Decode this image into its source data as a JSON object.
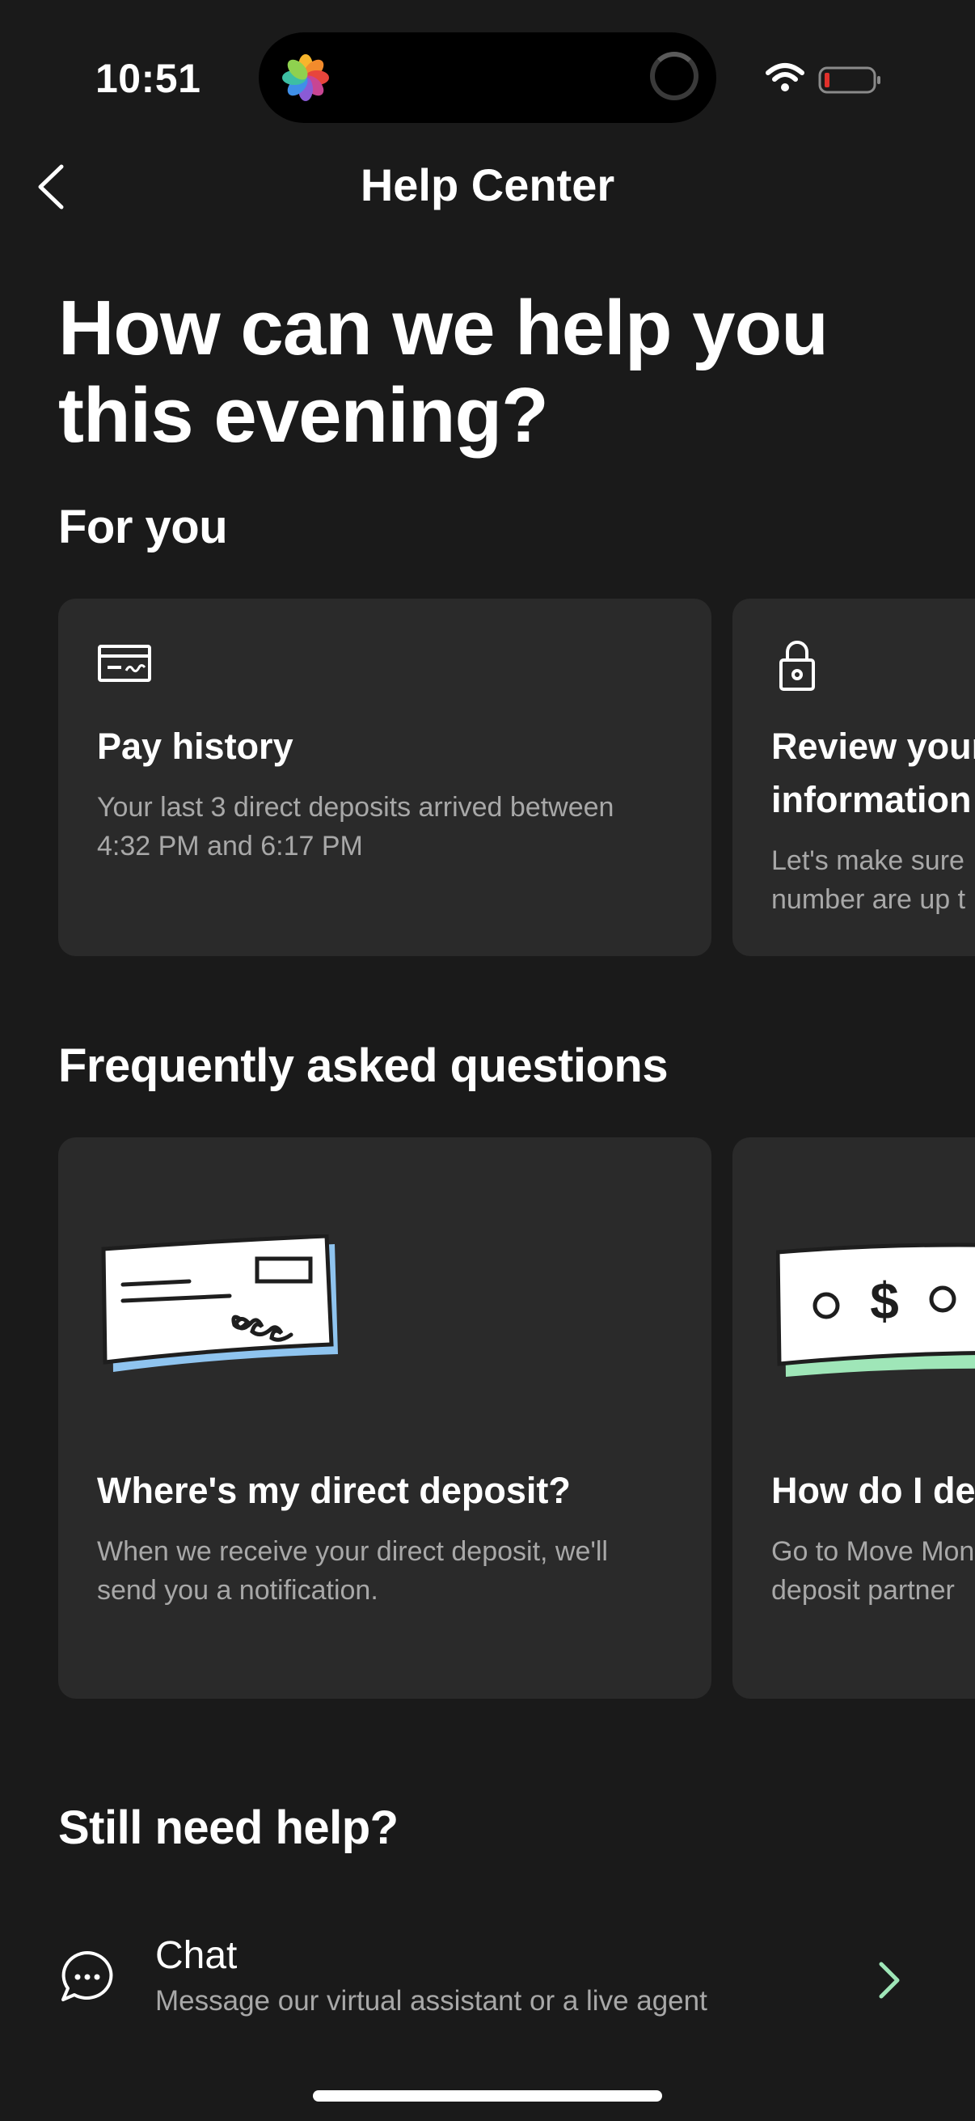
{
  "status_bar": {
    "time": "10:51"
  },
  "nav": {
    "title": "Help Center"
  },
  "headline": {
    "line1": "How can we help you",
    "line2": "this evening?"
  },
  "for_you": {
    "section_title": "For you",
    "cards": [
      {
        "icon": "check-card-icon",
        "title": "Pay history",
        "desc_line1": "Your last 3 direct deposits arrived between",
        "desc_line2": "4:32 PM and 6:17 PM"
      },
      {
        "icon": "lock-icon",
        "title_line1": "Review your",
        "title_line2": "information",
        "desc_line1": "Let's make sure",
        "desc_line2": "number are up t"
      }
    ]
  },
  "faq": {
    "section_title": "Frequently asked questions",
    "cards": [
      {
        "illustration": "check-illustration",
        "title": "Where's my direct deposit?",
        "desc_line1": "When we receive your direct deposit, we'll",
        "desc_line2": "send you a notification."
      },
      {
        "illustration": "dollar-bill-illustration",
        "title": "How do I de",
        "desc_line1": "Go to Move Mon",
        "desc_line2": "deposit partner"
      }
    ]
  },
  "help": {
    "section_title": "Still need help?",
    "chat": {
      "icon": "chat-bubble-icon",
      "title": "Chat",
      "desc": "Message our virtual assistant or a live agent"
    }
  },
  "colors": {
    "background": "#1a1a1a",
    "card": "#2a2a2a",
    "secondary_text": "#a8a8a8",
    "chevron": "#9fe6b8",
    "check_accent": "#8fc4ef",
    "bill_accent": "#9fe6b8",
    "battery_low": "#e0302b"
  }
}
